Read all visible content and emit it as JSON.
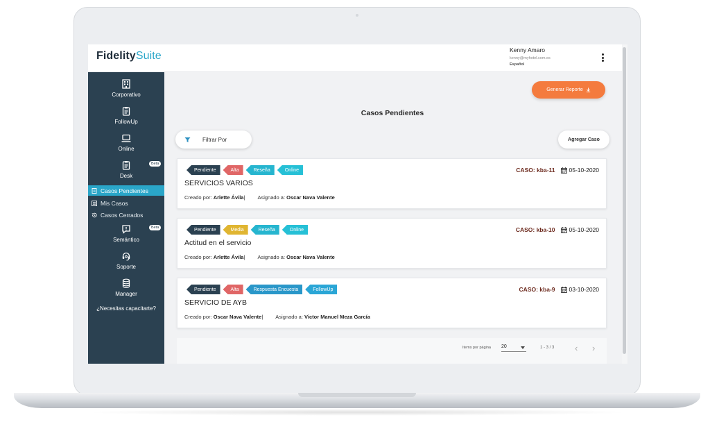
{
  "header": {
    "logo_bold": "Fidelity",
    "logo_light": "Suite",
    "user_name": "Kenny Amaro",
    "user_email": "kenny@myhotel.com.es",
    "language": "Español"
  },
  "sidebar": {
    "modules": [
      {
        "label": "Corporativo",
        "icon": "building-icon"
      },
      {
        "label": "FollowUp",
        "icon": "clipboard-icon"
      },
      {
        "label": "Online",
        "icon": "laptop-icon"
      },
      {
        "label": "Desk",
        "icon": "clipboard-icon",
        "badge": "Beta"
      },
      {
        "label": "Semántico",
        "icon": "comment-alert-icon",
        "badge": "Beta"
      },
      {
        "label": "Soporte",
        "icon": "headset-icon"
      },
      {
        "label": "Manager",
        "icon": "coins-icon"
      }
    ],
    "desk_items": [
      {
        "label": "Casos Pendientes",
        "icon": "document-icon",
        "active": true
      },
      {
        "label": "Mis Casos",
        "icon": "list-icon",
        "active": false
      },
      {
        "label": "Casos Cerrados",
        "icon": "history-icon",
        "active": false
      }
    ],
    "help": "¿Necesitas capacitarte?"
  },
  "main": {
    "generate_label": "Generar Reporte",
    "title": "Casos Pendientes",
    "filter_label": "Filtrar Por",
    "add_label": "Agregar Caso",
    "created_prefix": "Creado por:",
    "assigned_prefix": "Asignado a:",
    "cases": [
      {
        "tags": [
          {
            "label": "Pendiente",
            "color": "#2b4151"
          },
          {
            "label": "Alta",
            "color": "#e06666"
          },
          {
            "label": "Reseña",
            "color": "#26b5cf"
          },
          {
            "label": "Online",
            "color": "#26c0d6"
          }
        ],
        "case_label": "CASO: kba-11",
        "date": "05-10-2020",
        "title": "SERVICIOS VARIOS",
        "created_by": "Arlette Ávila",
        "assigned_to": "Oscar Nava Valente"
      },
      {
        "tags": [
          {
            "label": "Pendiente",
            "color": "#2b4151"
          },
          {
            "label": "Media",
            "color": "#e0b531"
          },
          {
            "label": "Reseña",
            "color": "#26b5cf"
          },
          {
            "label": "Online",
            "color": "#26c0d6"
          }
        ],
        "case_label": "CASO: kba-10",
        "date": "05-10-2020",
        "title": "Actitud en el servicio",
        "created_by": "Arlette Ávila",
        "assigned_to": "Oscar Nava Valente"
      },
      {
        "tags": [
          {
            "label": "Pendiente",
            "color": "#2b4151"
          },
          {
            "label": "Alta",
            "color": "#e06666"
          },
          {
            "label": "Respuesta Encuesta",
            "color": "#2a97c9"
          },
          {
            "label": "FollowUp",
            "color": "#2aa6d6"
          }
        ],
        "case_label": "CASO: kba-9",
        "date": "03-10-2020",
        "title": "SERVICIO DE AYB",
        "created_by": "Oscar Nava Valente",
        "assigned_to": "Victor Manuel Meza García"
      }
    ],
    "pager": {
      "items_label": "Items por página",
      "page_size": "20",
      "range": "1 - 3 / 3"
    }
  },
  "colors": {
    "sidebar": "#2b4151",
    "accent": "#2aa6c9",
    "generate_button": "#f47b3e",
    "case_id": "#6d2b1f"
  }
}
